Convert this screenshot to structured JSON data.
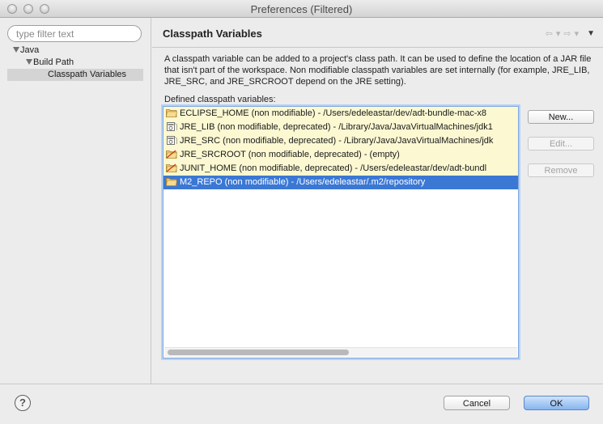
{
  "window": {
    "title": "Preferences (Filtered)"
  },
  "filter": {
    "placeholder": "type filter text",
    "value": ""
  },
  "tree": [
    {
      "label": "Java",
      "expanded": true
    },
    {
      "label": "Build Path",
      "expanded": true
    },
    {
      "label": "Classpath Variables",
      "selected": true
    }
  ],
  "page": {
    "title": "Classpath Variables",
    "description": "A classpath variable can be added to a project's class path. It can be used to define the location of a JAR file that isn't part of the workspace. Non modifiable classpath variables are set internally (for example, JRE_LIB, JRE_SRC, and JRE_SRCROOT depend on the JRE setting).",
    "list_label": "Defined classpath variables:"
  },
  "variables": [
    {
      "text": "ECLIPSE_HOME (non modifiable) - /Users/edeleastar/dev/adt-bundle-mac-x8",
      "icon": "folder-icon"
    },
    {
      "text": "JRE_LIB (non modifiable, deprecated) - /Library/Java/JavaVirtualMachines/jdk1",
      "icon": "jar-icon"
    },
    {
      "text": "JRE_SRC (non modifiable, deprecated) - /Library/Java/JavaVirtualMachines/jdk",
      "icon": "jar-icon"
    },
    {
      "text": "JRE_SRCROOT (non modifiable, deprecated) - (empty)",
      "icon": "folder-deprecated-icon"
    },
    {
      "text": "JUNIT_HOME (non modifiable, deprecated) - /Users/edeleastar/dev/adt-bundl",
      "icon": "folder-deprecated-icon"
    },
    {
      "text": "M2_REPO (non modifiable) - /Users/edeleastar/.m2/repository",
      "icon": "folder-icon",
      "selected": true
    }
  ],
  "buttons": {
    "new": "New...",
    "edit": "Edit...",
    "remove": "Remove",
    "cancel": "Cancel",
    "ok": "OK"
  },
  "icons": {
    "help": "?"
  },
  "colors": {
    "selection": "#3b78d4",
    "nonmodifiable_row": "#fbf8d2",
    "ok_button": "#86b5ef"
  }
}
